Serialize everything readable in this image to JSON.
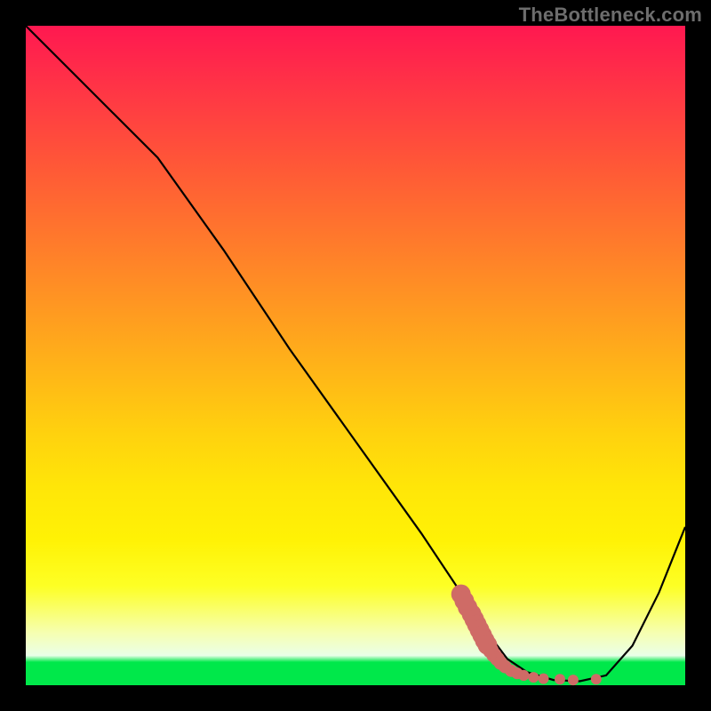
{
  "watermark": "TheBottleneck.com",
  "chart_data": {
    "type": "line",
    "title": "",
    "xlabel": "",
    "ylabel": "",
    "xlim": [
      0,
      100
    ],
    "ylim": [
      0,
      100
    ],
    "grid": false,
    "legend": false,
    "series": [
      {
        "name": "bottleneck-curve",
        "color": "#000000",
        "x": [
          0,
          8,
          20,
          30,
          40,
          50,
          60,
          66,
          70,
          73,
          76,
          80,
          84,
          88,
          92,
          96,
          100
        ],
        "y": [
          100,
          92,
          80,
          66,
          51,
          37,
          23,
          14,
          8,
          4,
          2,
          0.8,
          0.6,
          1.5,
          6,
          14,
          24
        ]
      },
      {
        "name": "highlight-dots",
        "color": "#cf6b66",
        "type": "scatter",
        "x": [
          66.0,
          66.5,
          67.0,
          67.6,
          68.0,
          68.4,
          68.8,
          69.2,
          69.6,
          70.0,
          70.5,
          71.0,
          71.5,
          72.0,
          72.7,
          73.6,
          74.5,
          75.5,
          77.0,
          78.5,
          81.0,
          83.0,
          86.5
        ],
        "y": [
          13.8,
          12.8,
          11.8,
          10.8,
          10.0,
          9.2,
          8.4,
          7.6,
          6.8,
          6.1,
          5.3,
          4.6,
          4.0,
          3.4,
          2.8,
          2.2,
          1.8,
          1.5,
          1.2,
          1.0,
          0.9,
          0.8,
          0.9
        ],
        "size_hint": "first ~10 points large (r≈11), trailing points small (r≈6)"
      }
    ],
    "background": "rainbow vertical gradient red→yellow→green"
  }
}
